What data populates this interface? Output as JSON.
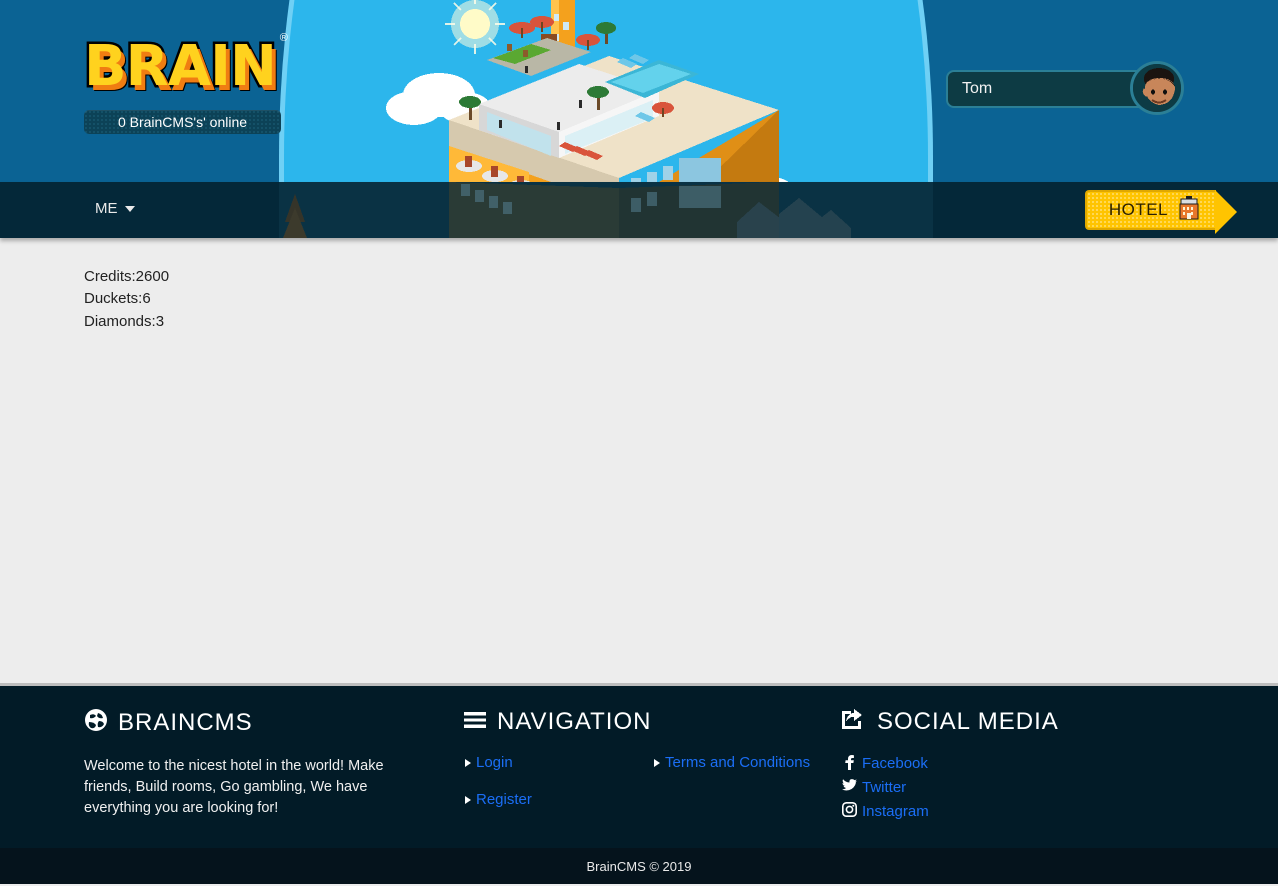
{
  "header": {
    "logo_text": "BRAIN",
    "logo_registered": "®",
    "online_badge": "0 BrainCMS's' online",
    "username": "Tom",
    "avatar_icon": "user-avatar-icon",
    "arch_icon": "hotel-illustration"
  },
  "navbar": {
    "me_label": "ME",
    "me_caret_icon": "chevron-down-icon",
    "hotel_label": "HOTEL",
    "hotel_icon": "hotel-building-icon"
  },
  "main": {
    "stats": [
      "Credits:2600",
      "Duckets:6",
      "Diamonds:3"
    ]
  },
  "footer": {
    "columns": [
      {
        "icon": "globe-icon",
        "title": "BRAINCMS",
        "description": "Welcome to the nicest hotel in the world! Make friends, Build rooms, Go gambling, We have everything you are looking for!"
      },
      {
        "icon": "hamburger-icon",
        "title": "NAVIGATION",
        "links": [
          {
            "label": "Login",
            "bullet_icon": "triangle-right-icon"
          },
          {
            "label": "Register",
            "bullet_icon": "triangle-right-icon"
          },
          {
            "label": "Terms and Conditions",
            "bullet_icon": "triangle-right-icon"
          }
        ]
      },
      {
        "icon": "share-icon",
        "title": "SOCIAL MEDIA",
        "links": [
          {
            "label": "Facebook",
            "icon": "facebook-icon",
            "glyph": "f"
          },
          {
            "label": "Twitter",
            "icon": "twitter-icon",
            "glyph": "ᴠ"
          },
          {
            "label": "Instagram",
            "icon": "instagram-icon",
            "glyph": "▣"
          }
        ]
      }
    ],
    "copyright": "BrainCMS © 2019"
  },
  "colors": {
    "header_blue": "#0b6394",
    "arch_blue": "#2cb6ec",
    "arch_outline": "#6fd0f5",
    "navbar_dark": "#042839",
    "footer_dark": "#021b27",
    "copybar_dark": "#05131c",
    "body_gray": "#ededed",
    "accent_yellow": "#ffc400",
    "link_blue": "#1b6ef5",
    "logo_yellow": "#ffd21e",
    "logo_orange": "#f07d12"
  }
}
